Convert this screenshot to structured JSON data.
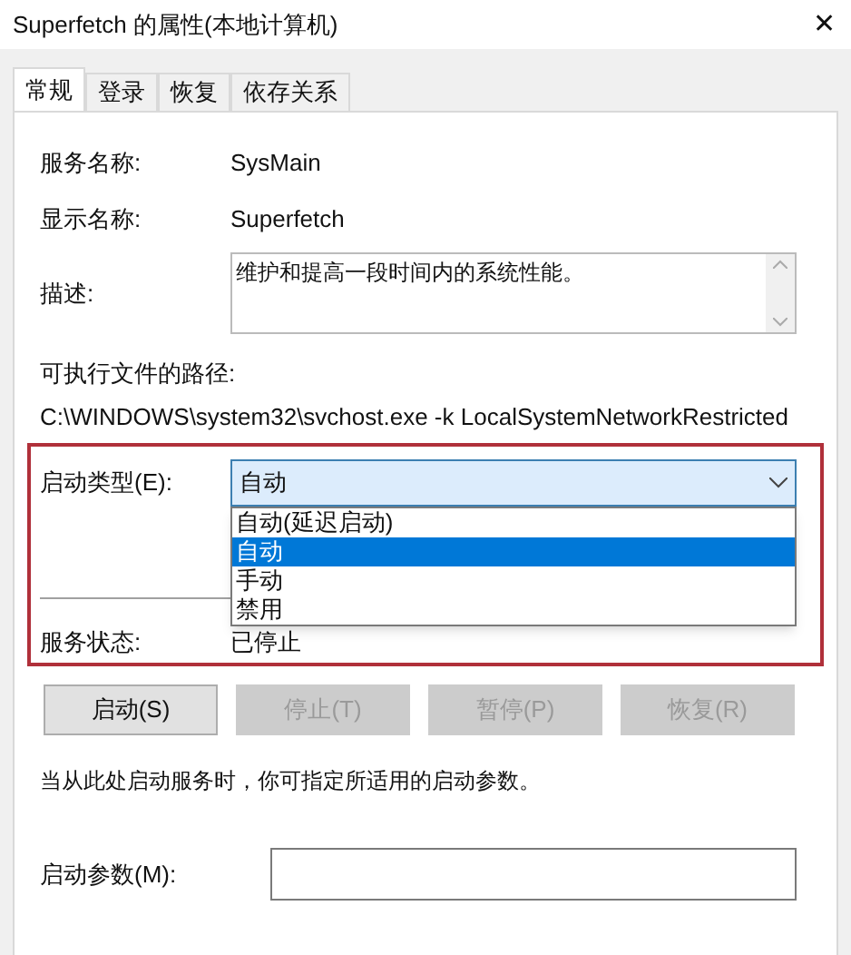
{
  "window": {
    "title": "Superfetch 的属性(本地计算机)",
    "close": "✕"
  },
  "tabs": [
    {
      "label": "常规",
      "selected": true
    },
    {
      "label": "登录",
      "selected": false
    },
    {
      "label": "恢复",
      "selected": false
    },
    {
      "label": "依存关系",
      "selected": false
    }
  ],
  "service_name": {
    "label": "服务名称:",
    "value": "SysMain"
  },
  "display_name": {
    "label": "显示名称:",
    "value": "Superfetch"
  },
  "description": {
    "label": "描述:",
    "value": "维护和提高一段时间内的系统性能。"
  },
  "path": {
    "label": "可执行文件的路径:",
    "value": "C:\\WINDOWS\\system32\\svchost.exe -k LocalSystemNetworkRestricted"
  },
  "startup_type": {
    "label": "启动类型(E):",
    "value": "自动",
    "expanded": true,
    "options": [
      {
        "label": "自动(延迟启动)",
        "selected": false
      },
      {
        "label": "自动",
        "selected": true
      },
      {
        "label": "手动",
        "selected": false
      },
      {
        "label": "禁用",
        "selected": false
      }
    ]
  },
  "service_status": {
    "label": "服务状态:",
    "value": "已停止"
  },
  "buttons": [
    {
      "label": "启动(S)",
      "disabled": false
    },
    {
      "label": "停止(T)",
      "disabled": true
    },
    {
      "label": "暂停(P)",
      "disabled": true
    },
    {
      "label": "恢复(R)",
      "disabled": true
    }
  ],
  "hint": "当从此处启动服务时，你可指定所适用的启动参数。",
  "start_params": {
    "label": "启动参数(M):"
  }
}
